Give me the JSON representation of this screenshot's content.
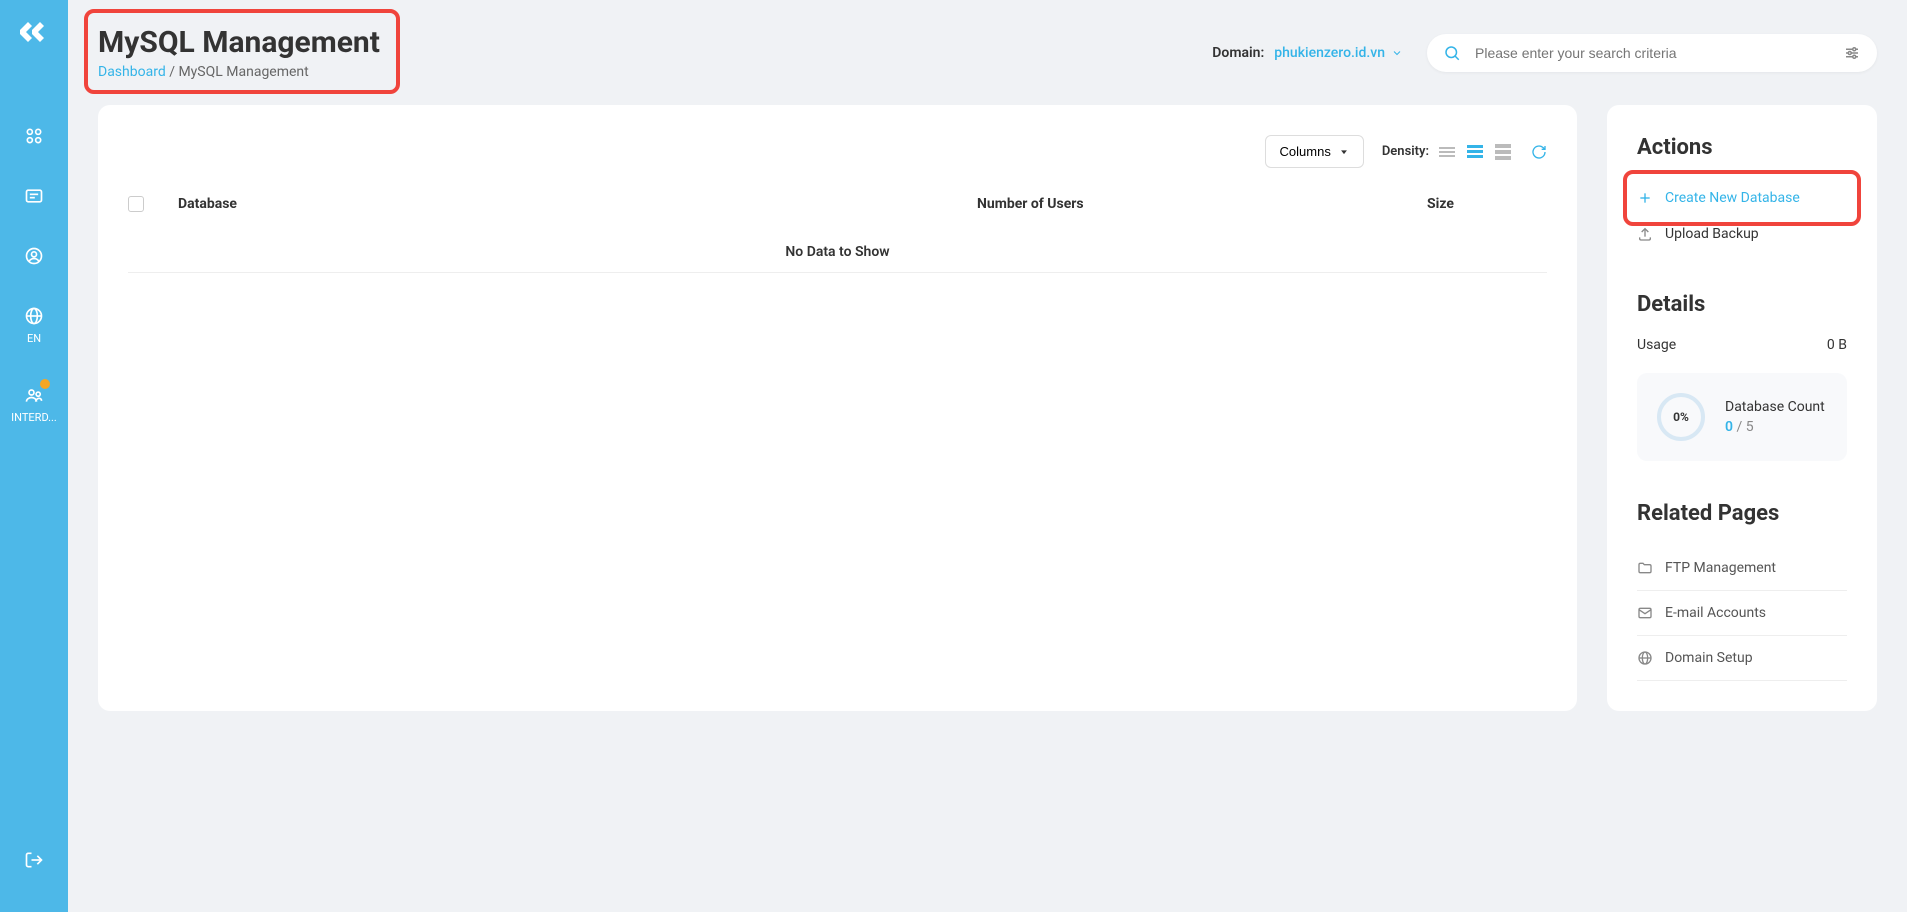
{
  "header": {
    "title": "MySQL Management",
    "breadcrumb_link": "Dashboard",
    "breadcrumb_sep": " / ",
    "breadcrumb_current": "MySQL Management",
    "domain_label": "Domain:",
    "domain_value": "phukienzero.id.vn",
    "search_placeholder": "Please enter your search criteria"
  },
  "sidebar": {
    "lang": "EN",
    "user_label": "INTERD..."
  },
  "table": {
    "columns_btn": "Columns",
    "density_label": "Density:",
    "headers": {
      "db": "Database",
      "users": "Number of Users",
      "size": "Size"
    },
    "no_data": "No Data to Show"
  },
  "actions": {
    "title": "Actions",
    "create": "Create New Database",
    "upload": "Upload Backup"
  },
  "details": {
    "title": "Details",
    "usage_label": "Usage",
    "usage_value": "0 B",
    "pct": "0%",
    "count_label": "Database Count",
    "count_current": "0",
    "count_sep": " / ",
    "count_max": "5"
  },
  "related": {
    "title": "Related Pages",
    "items": [
      "FTP Management",
      "E-mail Accounts",
      "Domain Setup"
    ]
  }
}
